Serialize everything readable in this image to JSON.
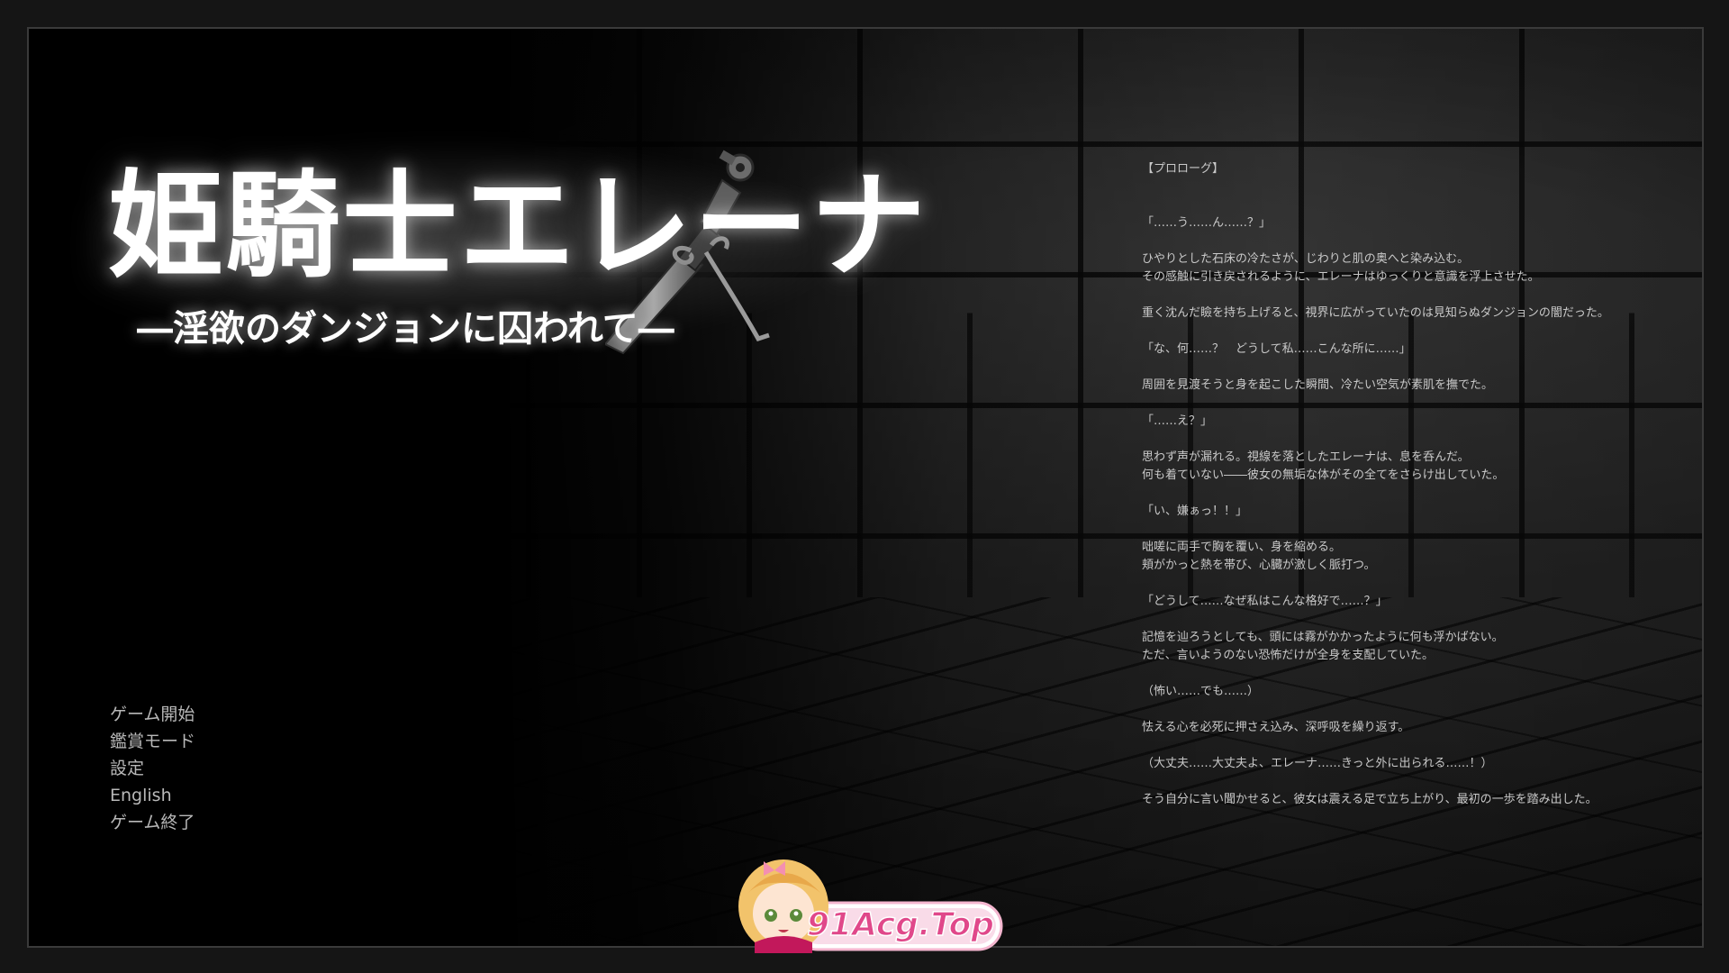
{
  "title": {
    "main": "姫騎士エレーナ",
    "sub": "―淫欲のダンジョンに囚われて―"
  },
  "menu": {
    "items": [
      {
        "label": "ゲーム開始"
      },
      {
        "label": "鑑賞モード"
      },
      {
        "label": "設定"
      },
      {
        "label": "English"
      },
      {
        "label": "ゲーム終了"
      }
    ]
  },
  "prologue": {
    "heading": "【プロローグ】",
    "paragraphs": [
      "「……う……ん……？」",
      "ひやりとした石床の冷たさが、じわりと肌の奥へと染み込む。\nその感触に引き戻されるように、エレーナはゆっくりと意識を浮上させた。",
      "重く沈んだ瞼を持ち上げると、視界に広がっていたのは見知らぬダンジョンの闇だった。",
      "「な、何……？　どうして私……こんな所に……」",
      "周囲を見渡そうと身を起こした瞬間、冷たい空気が素肌を撫でた。",
      "「……え？」",
      "思わず声が漏れる。視線を落としたエレーナは、息を呑んだ。\n何も着ていない――彼女の無垢な体がその全てをさらけ出していた。",
      "「い、嫌ぁっ！！」",
      "咄嗟に両手で胸を覆い、身を縮める。\n頬がかっと熱を帯び、心臓が激しく脈打つ。",
      "「どうして……なぜ私はこんな格好で……？」",
      "記憶を辿ろうとしても、頭には霧がかかったように何も浮かばない。\nただ、言いようのない恐怖だけが全身を支配していた。",
      "（怖い……でも……）",
      "怯える心を必死に押さえ込み、深呼吸を繰り返す。",
      "（大丈夫……大丈夫よ、エレーナ……きっと外に出られる……！）",
      "そう自分に言い聞かせると、彼女は震える足で立ち上がり、最初の一歩を踏み出した。"
    ]
  },
  "watermark": {
    "text": "91Acg.Top"
  },
  "colors": {
    "title": "#ffffff",
    "menu_text": "#b8b8b8",
    "prologue_text": "#c9c9c9",
    "frame_border": "#3a3a3a",
    "watermark_pink": "#e0488a"
  }
}
